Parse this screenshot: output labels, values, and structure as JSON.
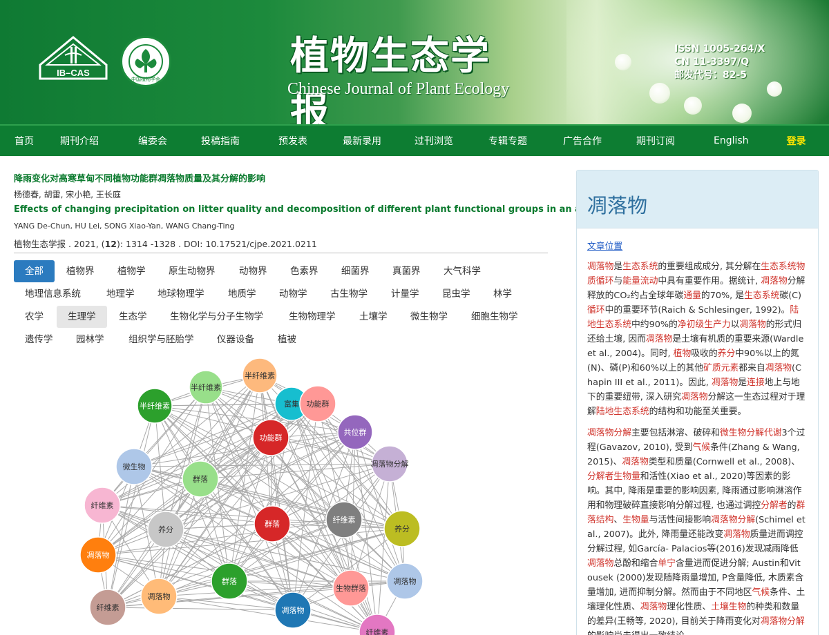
{
  "header": {
    "title_cn": "植物生态学报",
    "title_en": "Chinese Journal of Plant Ecology",
    "logo_text": "IB–CAS",
    "seal_text": "中国植物学会",
    "issn": "ISSN 1005-264/X",
    "cn": "CN 11-3397/Q",
    "postal": "邮发代号：82-5"
  },
  "nav": {
    "items": [
      "首页",
      "期刊介绍",
      "编委会",
      "投稿指南",
      "预发表",
      "最新录用",
      "过刊浏览",
      "专辑专题",
      "广告合作",
      "期刊订阅",
      "English"
    ],
    "login": "登录"
  },
  "article": {
    "title_cn": "降雨变化对高寒草甸不同植物功能群凋落物质量及其分解的影响",
    "authors_cn": "杨德春, 胡雷, 宋小艳, 王长庭",
    "title_en": "Effects of changing precipitation on litter quality and decomposition of different plant functional groups in an alpine meadow",
    "authors_en": "YANG De-Chun, HU Lei, SONG Xiao-Yan, WANG Chang-Ting",
    "citation_pre": "植物生态学报 . 2021, (",
    "citation_issue": "12",
    "citation_post": "): 1314 -1328 .  DOI: 10.17521/cjpe.2021.0211"
  },
  "categories": [
    "全部",
    "植物界",
    "植物学",
    "原生动物界",
    "动物界",
    "色素界",
    "细菌界",
    "真菌界",
    "大气科学",
    "地理信息系统",
    "地理学",
    "地球物理学",
    "地质学",
    "动物学",
    "古生物学",
    "计量学",
    "昆虫学",
    "林学",
    "农学",
    "生理学",
    "生态学",
    "生物化学与分子生物学",
    "生物物理学",
    "土壤学",
    "微生物学",
    "细胞生物学",
    "遗传学",
    "园林学",
    "组织学与胚胎学",
    "仪器设备",
    "植被"
  ],
  "network": {
    "nodes": [
      {
        "label": "半纤维素",
        "color": "#fdb97d"
      },
      {
        "label": "半纤维素",
        "color": "#98df8a"
      },
      {
        "label": "半纤维素",
        "color": "#2ca02c"
      },
      {
        "label": "富集",
        "color": "#17becf"
      },
      {
        "label": "功能群",
        "color": "#ff9896"
      },
      {
        "label": "功能群",
        "color": "#d62728"
      },
      {
        "label": "共位群",
        "color": "#9467bd"
      },
      {
        "label": "凋落物分解",
        "color": "#c5b0d5"
      },
      {
        "label": "微生物",
        "color": "#aec7e8"
      },
      {
        "label": "群落",
        "color": "#98df8a"
      },
      {
        "label": "纤维素",
        "color": "#f7b6d2"
      },
      {
        "label": "养分",
        "color": "#c7c7c7"
      },
      {
        "label": "群落",
        "color": "#d62728"
      },
      {
        "label": "纤维素",
        "color": "#7f7f7f"
      },
      {
        "label": "养分",
        "color": "#bcbd22"
      },
      {
        "label": "凋落物",
        "color": "#ff7f0e"
      },
      {
        "label": "群落",
        "color": "#2ca02c"
      },
      {
        "label": "生物群落",
        "color": "#ff9896"
      },
      {
        "label": "凋落物",
        "color": "#aec7e8"
      },
      {
        "label": "纤维素",
        "color": "#c49c94"
      },
      {
        "label": "凋落物",
        "color": "#ffbb78"
      },
      {
        "label": "凋落物",
        "color": "#1f77b4"
      },
      {
        "label": "纤维素",
        "color": "#e377c2"
      }
    ]
  },
  "sidebar": {
    "heading": "凋落物",
    "link": "文章位置",
    "paragraphs": [
      [
        [
          "凋落物",
          1
        ],
        [
          "是",
          0
        ],
        [
          "生态系统",
          1
        ],
        [
          "的重要组成成分, 其分解在",
          0
        ],
        [
          "生态系统物质循环",
          1
        ],
        [
          "与",
          0
        ],
        [
          "能量流动",
          1
        ],
        [
          "中具有重要作用。据统计, ",
          0
        ],
        [
          "凋落物",
          1
        ],
        [
          "分解释放的CO₂约占全球年碳",
          0
        ],
        [
          "通量",
          1
        ],
        [
          "的70%, 是",
          0
        ],
        [
          "生态系统",
          1
        ],
        [
          "碳(C)",
          0
        ],
        [
          "循环",
          1
        ],
        [
          "中的重要环节(Raich & Schlesinger, 1992)。",
          0
        ],
        [
          "陆地生态系统",
          1
        ],
        [
          "中约90%的",
          0
        ],
        [
          "净初级生产力",
          1
        ],
        [
          "以",
          0
        ],
        [
          "凋落物",
          1
        ],
        [
          "的形式归还给土壤, 因而",
          0
        ],
        [
          "凋落物",
          1
        ],
        [
          "是土壤有机质的重要来源(Wardle et al., 2004)。同时, ",
          0
        ],
        [
          "植物",
          1
        ],
        [
          "吸收的",
          0
        ],
        [
          "养分",
          1
        ],
        [
          "中90%以上的氮(N)、磷(P)和60%以上的其他",
          0
        ],
        [
          "矿质元素",
          1
        ],
        [
          "都来自",
          0
        ],
        [
          "凋落物",
          1
        ],
        [
          "(Chapin III et al., 2011)。因此, ",
          0
        ],
        [
          "凋落物",
          1
        ],
        [
          "是",
          0
        ],
        [
          "连接",
          1
        ],
        [
          "地上与地下的重要纽带, 深入研究",
          0
        ],
        [
          "凋落物",
          1
        ],
        [
          "分解这一生态过程对于理解",
          0
        ],
        [
          "陆地生态系统",
          1
        ],
        [
          "的结构和功能至关重要。",
          0
        ]
      ],
      [
        [
          "凋落物分解",
          1
        ],
        [
          "主要包括淋溶、破碎和",
          0
        ],
        [
          "微生物分解代谢",
          1
        ],
        [
          "3个过程(Gavazov, 2010), 受到",
          0
        ],
        [
          "气候",
          1
        ],
        [
          "条件(Zhang & Wang, 2015)、",
          0
        ],
        [
          "凋落物",
          1
        ],
        [
          "类型和质量(Cornwell et al., 2008)、",
          0
        ],
        [
          "分解者",
          1
        ],
        [
          "生物量",
          1
        ],
        [
          "和活性(Xiao et al., 2020)等因素的影响。其中, 降雨是重要的影响因素, 降雨通过影响淋溶作用和物理破碎直接影响分解过程, 也通过调控",
          0
        ],
        [
          "分解者",
          1
        ],
        [
          "的",
          0
        ],
        [
          "群落结构",
          1
        ],
        [
          "、",
          0
        ],
        [
          "生物量",
          1
        ],
        [
          "与活性间接影响",
          0
        ],
        [
          "凋落物分解",
          1
        ],
        [
          "(Schimel et al., 2007)。此外, 降雨量还能改变",
          0
        ],
        [
          "凋落物",
          1
        ],
        [
          "质量进而调控分解过程, 如García- Palacios等(2016)发现减雨降低",
          0
        ],
        [
          "凋落物",
          1
        ],
        [
          "总酚和缩合",
          0
        ],
        [
          "单宁",
          1
        ],
        [
          "含量进而促进分解; Austin和Vitousek (2000)发现随降雨量增加, P含量降低, 木质素含量增加, 进而抑制分解。然而由于不同地区",
          0
        ],
        [
          "气候",
          1
        ],
        [
          "条件、土壤理化性质、",
          0
        ],
        [
          "凋落物",
          1
        ],
        [
          "理化性质、",
          0
        ],
        [
          "土壤生物",
          1
        ],
        [
          "的种类和数量的差异(王畅等, 2020), 目前关于降雨变化对",
          0
        ],
        [
          "凋落物分解",
          1
        ],
        [
          "的影响尚未得出一致结论。",
          0
        ]
      ]
    ]
  }
}
